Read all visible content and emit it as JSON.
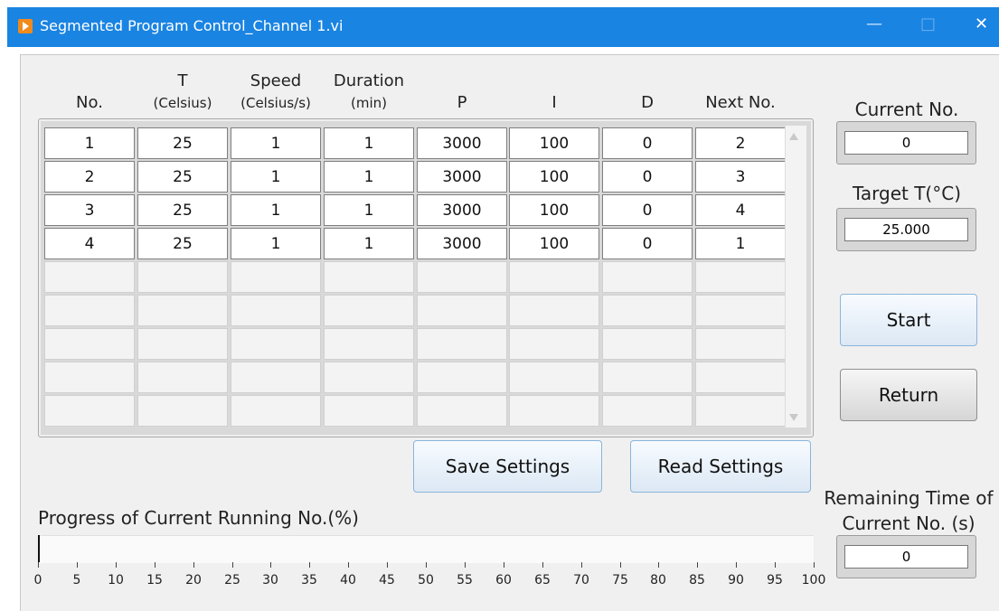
{
  "window": {
    "title": "Segmented Program Control_Channel 1.vi",
    "min_glyph": "—",
    "max_glyph": "□",
    "close_glyph": "✕",
    "titlebar_color": "#1a84e2"
  },
  "table": {
    "headers": [
      {
        "line1": "",
        "line2": "No."
      },
      {
        "line1": "T",
        "line2": "(Celsius)"
      },
      {
        "line1": "Speed",
        "line2": "(Celsius/s)"
      },
      {
        "line1": "Duration",
        "line2": "(min)"
      },
      {
        "line1": "",
        "line2": "P"
      },
      {
        "line1": "",
        "line2": "I"
      },
      {
        "line1": "",
        "line2": "D"
      },
      {
        "line1": "",
        "line2": "Next No."
      }
    ],
    "rows": [
      [
        "1",
        "25",
        "1",
        "1",
        "3000",
        "100",
        "0",
        "2"
      ],
      [
        "2",
        "25",
        "1",
        "1",
        "3000",
        "100",
        "0",
        "3"
      ],
      [
        "3",
        "25",
        "1",
        "1",
        "3000",
        "100",
        "0",
        "4"
      ],
      [
        "4",
        "25",
        "1",
        "1",
        "3000",
        "100",
        "0",
        "1"
      ]
    ],
    "total_rows": 9
  },
  "current_no": {
    "label": "Current No.",
    "value": "0"
  },
  "target_t": {
    "label": "Target T(°C)",
    "value": "25.000"
  },
  "buttons": {
    "start": "Start",
    "return": "Return",
    "save": "Save Settings",
    "read": "Read Settings"
  },
  "progress": {
    "label": "Progress of Current Running No.(%)",
    "value_percent": 0,
    "ticks": [
      "0",
      "5",
      "10",
      "15",
      "20",
      "25",
      "30",
      "35",
      "40",
      "45",
      "50",
      "55",
      "60",
      "65",
      "70",
      "75",
      "80",
      "85",
      "90",
      "95",
      "100"
    ]
  },
  "remaining": {
    "label_line1": "Remaining Time of",
    "label_line2": "Current No. (s)",
    "value": "0"
  }
}
